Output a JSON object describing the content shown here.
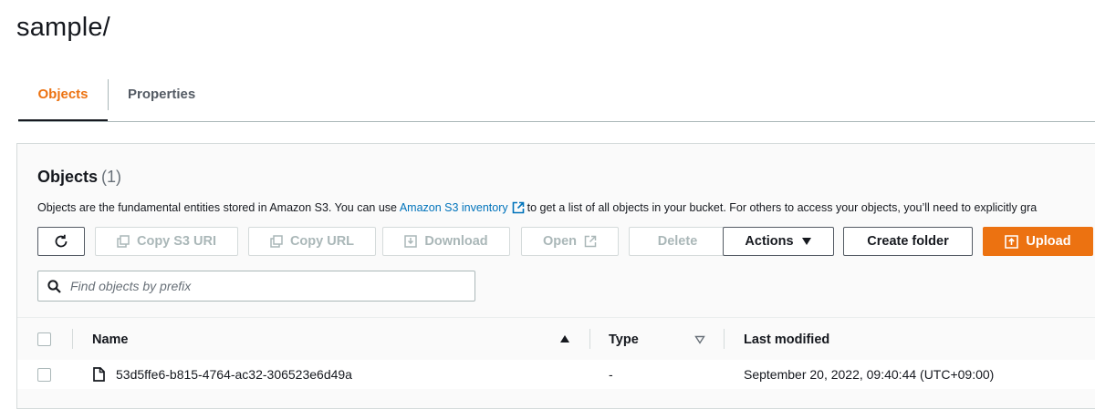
{
  "page": {
    "title": "sample/"
  },
  "tabs": [
    {
      "label": "Objects",
      "active": true
    },
    {
      "label": "Properties",
      "active": false
    }
  ],
  "objects_panel": {
    "title": "Objects",
    "count": "(1)",
    "description_before": "Objects are the fundamental entities stored in Amazon S3. You can use",
    "description_link": "Amazon S3 inventory",
    "description_after": "to get a list of all objects in your bucket. For others to access your objects, you’ll need to explicitly gra"
  },
  "toolbar": {
    "refresh_icon": "refresh-icon",
    "copy_s3_uri_label": "Copy S3 URI",
    "copy_url_label": "Copy URL",
    "download_label": "Download",
    "open_label": "Open",
    "delete_label": "Delete",
    "actions_label": "Actions",
    "create_folder_label": "Create folder",
    "upload_label": "Upload"
  },
  "search": {
    "placeholder": "Find objects by prefix",
    "value": ""
  },
  "table": {
    "columns": [
      {
        "label": "Name",
        "sort": "ascending"
      },
      {
        "label": "Type",
        "sort": "none"
      },
      {
        "label": "Last modified",
        "sort": "none"
      }
    ],
    "rows": [
      {
        "name": "53d5ffe6-b815-4764-ac32-306523e6d49a",
        "type": "-",
        "last_modified": "September 20, 2022, 09:40:44 (UTC+09:00)",
        "icon": "file-icon"
      }
    ]
  },
  "colors": {
    "accent": "#ec7211",
    "link": "#0073bb",
    "text": "#16191f",
    "muted": "#545b64",
    "disabled": "#aab7b8"
  }
}
